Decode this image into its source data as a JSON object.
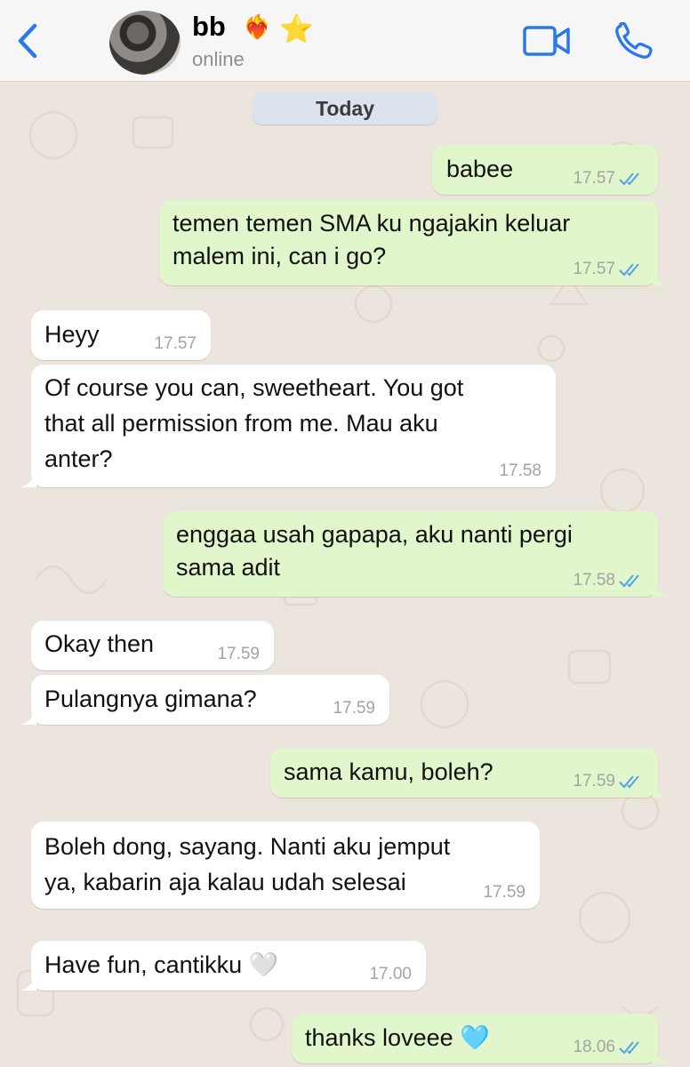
{
  "header": {
    "back_icon": "chevron-left-icon",
    "contact_name": "bb",
    "contact_emoji_1": "❤‍🔥",
    "contact_emoji_2": "⭐",
    "status": "online",
    "video_icon": "video-camera-icon",
    "call_icon": "phone-icon",
    "accent_color": "#2b78ee"
  },
  "chat": {
    "date_label": "Today",
    "messages": [
      {
        "dir": "out",
        "text": "babee",
        "time": "17.57",
        "read": true
      },
      {
        "dir": "out",
        "text": "temen temen SMA ku ngajakin keluar\nmalem ini, can i go?",
        "time": "17.57",
        "read": true
      },
      {
        "dir": "in",
        "text": "Heyy",
        "time": "17.57"
      },
      {
        "dir": "in",
        "text": "Of course you can, sweetheart. You got\nthat all permission from me. Mau aku\nanter?",
        "time": "17.58"
      },
      {
        "dir": "out",
        "text": "enggaa usah gapapa, aku nanti pergi\nsama adit",
        "time": "17.58",
        "read": true
      },
      {
        "dir": "in",
        "text": "Okay then",
        "time": "17.59"
      },
      {
        "dir": "in",
        "text": "Pulangnya gimana?",
        "time": "17.59"
      },
      {
        "dir": "out",
        "text": "sama kamu, boleh?",
        "time": "17.59",
        "read": true
      },
      {
        "dir": "in",
        "text": "Boleh dong, sayang. Nanti aku jemput\nya, kabarin aja kalau udah selesai",
        "time": "17.59"
      },
      {
        "dir": "in",
        "text": "Have fun, cantikku 🤍",
        "time": "17.00"
      },
      {
        "dir": "out",
        "text": "thanks loveee 🩵",
        "time": "18.06",
        "read": true
      }
    ],
    "outgoing_color": "#e1f7cb",
    "incoming_color": "#ffffff",
    "read_tick_color": "#4fa3e6"
  }
}
